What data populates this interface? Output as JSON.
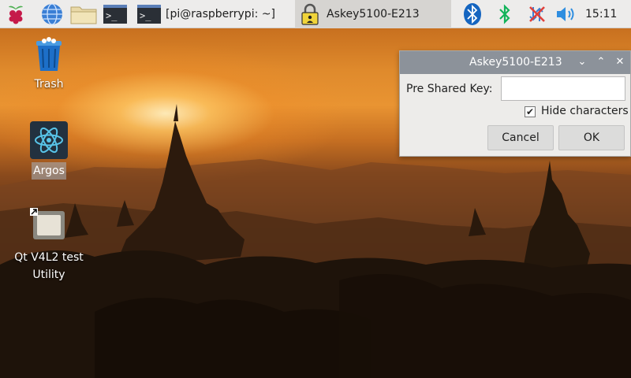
{
  "taskbar": {
    "tasks": [
      {
        "label": ""
      },
      {
        "label": "[pi@raspberrypi: ~]"
      },
      {
        "label": "Askey5100-E213"
      }
    ],
    "time": "15:11"
  },
  "desktop": {
    "icons": [
      {
        "label": "Trash"
      },
      {
        "label": "Argos"
      },
      {
        "label": "Qt V4L2 test Utility"
      }
    ]
  },
  "dialog": {
    "title": "Askey5100-E213",
    "key_label": "Pre Shared Key:",
    "key_value": "",
    "hide_label": "Hide characters",
    "hide_checked": true,
    "cancel_label": "Cancel",
    "ok_label": "OK"
  },
  "colors": {
    "taskbar_bg": "#edeceb",
    "dialog_title_bg": "#8c929a",
    "bluetooth_blue": "#1565c0",
    "bluetooth_green": "#12b35a",
    "network_error_red": "#e0403a",
    "volume_blue": "#2f8ee0"
  },
  "icons": [
    "raspberry-icon",
    "browser-globe-icon",
    "file-manager-icon",
    "terminal-icon",
    "lock-icon",
    "bluetooth-icon",
    "bluetooth-tray-icon",
    "network-disconnected-icon",
    "volume-icon",
    "trash-icon",
    "argos-atom-icon",
    "qt-v4l2-icon"
  ]
}
